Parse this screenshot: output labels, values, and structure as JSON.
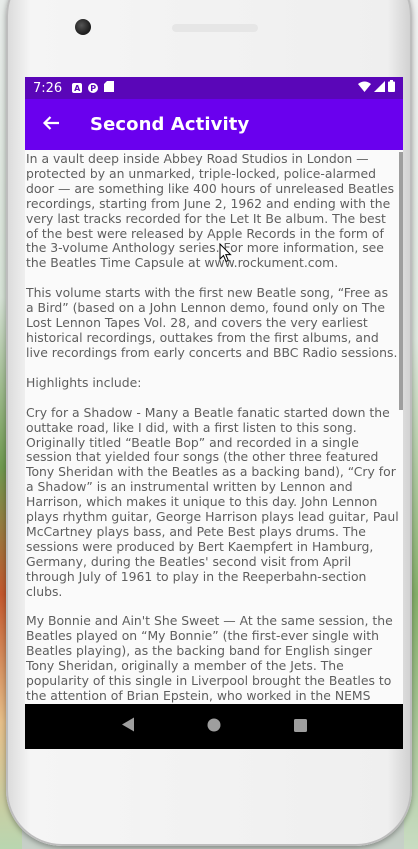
{
  "status_bar": {
    "time": "7:26",
    "icons": [
      "a-icon",
      "shield-icon",
      "sd-card-icon"
    ],
    "right_icons": [
      "wifi-icon",
      "signal-icon",
      "battery-icon"
    ]
  },
  "app_bar": {
    "title": "Second Activity",
    "back_icon": "arrow-back-icon"
  },
  "content": {
    "paragraphs": [
      "In a vault deep inside Abbey Road Studios in London — protected by an unmarked, triple-locked, police-alarmed door — are something like 400 hours of unreleased Beatles recordings, starting from June 2, 1962 and ending with the very last tracks recorded for the Let It Be album. The best of the best were released by Apple Records in the form of the 3-volume Anthology series. For more information, see the Beatles Time Capsule at www.rockument.com.",
      " This volume starts with the first new Beatle song, “Free as a Bird” (based on a John Lennon demo, found only on The Lost Lennon Tapes Vol. 28, and covers the very earliest historical recordings, outtakes from the first albums, and live recordings from early concerts and BBC Radio sessions.",
      " Highlights include:",
      " Cry for a Shadow - Many a Beatle fanatic started down the outtake road, like I did, with a first listen to this song. Originally titled “Beatle Bop” and recorded in a single session that yielded four songs (the other three featured Tony Sheridan with the Beatles as a backing band), “Cry for a Shadow” is an instrumental written by Lennon and Harrison, which makes it unique to this day. John Lennon plays rhythm guitar, George Harrison plays lead guitar, Paul McCartney plays bass, and Pete Best plays drums. The sessions were produced by Bert Kaempfert in Hamburg, Germany, during the Beatles' second visit from April through July of 1961 to play in the Reeperbahn-section clubs.",
      " My Bonnie and Ain't She Sweet — At the same session, the Beatles played on “My Bonnie” (the first-ever single with Beatles playing), as the backing band for English singer Tony Sheridan, originally a member of the Jets. The popularity of this single in Liverpool brought the Beatles to the attention of Brian Epstein, who worked in the NEMS record store and tried to meet demand for the disc. John Lennon then sings a fine “Ain't She Sweet” (his first-ever released vocal)."
    ]
  },
  "nav_bar": {
    "icons": [
      "back-triangle-icon",
      "home-circle-icon",
      "recents-square-icon"
    ]
  },
  "colors": {
    "status_bar": "#5a06b8",
    "app_bar": "#6a00ee",
    "text": "#5e5e5e"
  }
}
